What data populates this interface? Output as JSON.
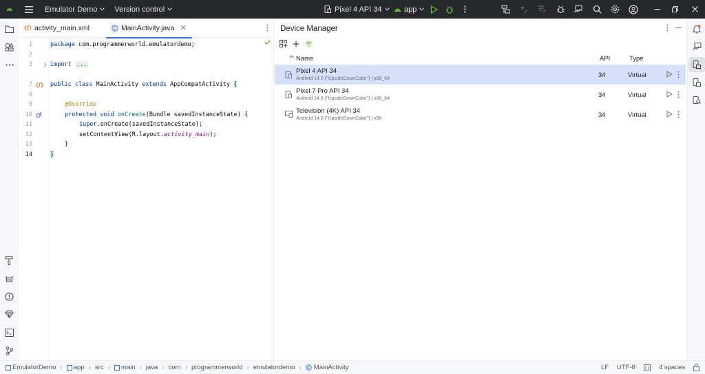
{
  "titlebar": {
    "project": "Emulator Demo",
    "vcs": "Version control",
    "device": "Pixel 4 API 34",
    "run_config": "app"
  },
  "editor": {
    "tabs": [
      {
        "label": "activity_main.xml",
        "active": false
      },
      {
        "label": "MainActivity.java",
        "active": true
      }
    ],
    "line_numbers": [
      "1",
      "2",
      "3",
      "7",
      "8",
      "9",
      "10",
      "11",
      "12",
      "13",
      "14"
    ],
    "code": {
      "l1_kw": "package",
      "l1_rest": " com.programmerworld.emulatordemo;",
      "l3_kw": "import",
      "l3_fold": "...",
      "l7_kw1": "public class",
      "l7_name": " MainActivity ",
      "l7_kw2": "extends",
      "l7_rest": " AppCompatActivity ",
      "l7_brace": "{",
      "l9_ann": "@Override",
      "l10_kw": "protected void",
      "l10_fn": " onCreate",
      "l10_rest": "(Bundle savedInstanceState) {",
      "l11_kw": "super",
      "l11_rest": ".onCreate(savedInstanceState);",
      "l12_a": "setContentView(R.layout.",
      "l12_it": "activity_main",
      "l12_b": ");",
      "l13": "}",
      "l14": "}"
    }
  },
  "device_manager": {
    "title": "Device Manager",
    "columns": {
      "name": "Name",
      "api": "API",
      "type": "Type"
    },
    "devices": [
      {
        "name": "Pixel 4 API 34",
        "subtitle": "Android 14.0 (\"UpsideDownCake\") | x86_64",
        "api": "34",
        "type": "Virtual",
        "selected": true,
        "icon": "phone-icon"
      },
      {
        "name": "Pixel 7 Pro API 34",
        "subtitle": "Android 14.0 (\"UpsideDownCake\") | x86_64",
        "api": "34",
        "type": "Virtual",
        "selected": false,
        "icon": "phone-icon"
      },
      {
        "name": "Television (4K) API 34",
        "subtitle": "Android 14.0 (\"UpsideDownCake\") | x86",
        "api": "34",
        "type": "Virtual",
        "selected": false,
        "icon": "tv-icon"
      }
    ]
  },
  "statusbar": {
    "breadcrumb": [
      "EmulatorDemo",
      "app",
      "src",
      "main",
      "java",
      "com",
      "programmerworld",
      "emulatordemo",
      "MainActivity"
    ],
    "line_sep": "LF",
    "encoding": "UTF-8",
    "indent": "4 spaces"
  },
  "colors": {
    "accent": "#3574f0",
    "selection": "#d5e1f8",
    "titlebar": "#27282c",
    "run_green": "#5fb832"
  }
}
